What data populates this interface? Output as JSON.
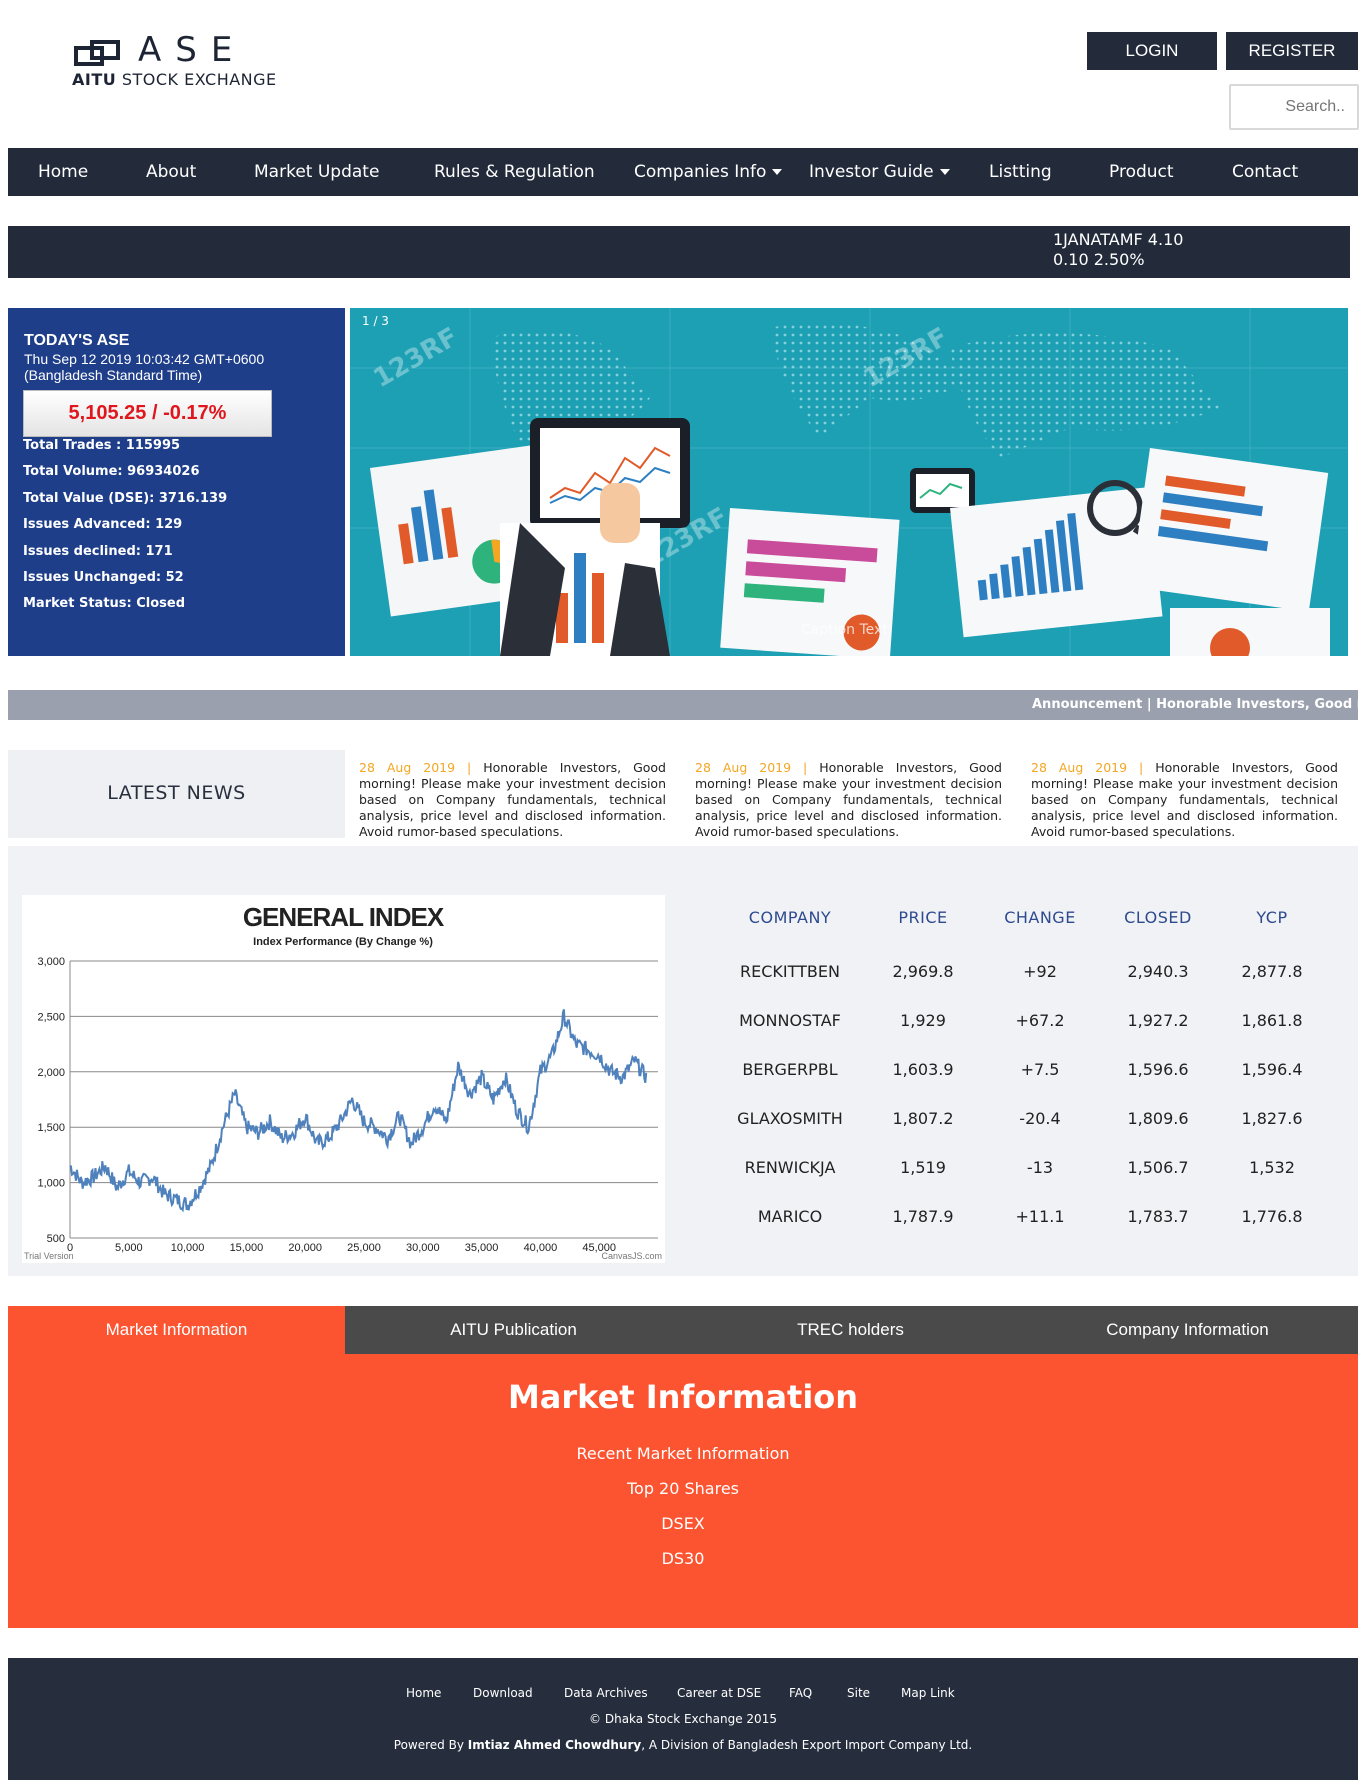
{
  "logo": {
    "brand": "ASE",
    "sub_bold": "AITU",
    "sub_rest": "STOCK EXCHANGE"
  },
  "header": {
    "login_label": "LOGIN",
    "register_label": "REGISTER",
    "search_placeholder": "Search.."
  },
  "nav": {
    "items": [
      "Home",
      "About",
      "Market Update",
      "Rules & Regulation",
      "Companies Info",
      "Investor Guide",
      "Listting",
      "Product",
      "Contact"
    ]
  },
  "ticker": {
    "line1": "1JANATAMF 4.10",
    "line2": "0.10 2.50%"
  },
  "today": {
    "title": "TODAY'S ASE",
    "datetime": "Thu Sep 12 2019 10:03:42 GMT+0600",
    "timezone": "(Bangladesh Standard Time)",
    "index_value": "5,105.25 / -0.17%",
    "stats": [
      "Total Trades : 115995",
      "Total Volume: 96934026",
      "Total Value (DSE): 3716.139",
      "Issues Advanced: 129",
      "Issues declined: 171",
      "Issues Unchanged: 52",
      "Market Status: Closed"
    ]
  },
  "slider": {
    "counter": "1 / 3",
    "caption": "Caption Text",
    "watermark": "123RF"
  },
  "announcement": {
    "text": "Announcement | Honorable Investors, Good mor"
  },
  "news": {
    "label": "LATEST NEWS",
    "items": [
      {
        "date": "28 Aug 2019 |",
        "text": "Honorable Investors, Good morning! Please make your investment decision based on Company fundamentals, technical analysis, price level and disclosed information. Avoid rumor-based speculations."
      },
      {
        "date": "28 Aug 2019 |",
        "text": "Honorable Investors, Good morning! Please make your investment decision based on Company fundamentals, technical analysis, price level and disclosed information. Avoid rumor-based speculations."
      },
      {
        "date": "28 Aug 2019 |",
        "text": "Honorable Investors, Good morning! Please make your investment decision based on Company fundamentals, technical analysis, price level and disclosed information. Avoid rumor-based speculations."
      }
    ]
  },
  "chart_data": {
    "type": "line",
    "title": "GENERAL INDEX",
    "subtitle": "Index Performance (By Change %)",
    "xlabel": "",
    "ylabel": "",
    "xlim": [
      0,
      50000
    ],
    "ylim": [
      500,
      3000
    ],
    "x_ticks": [
      0,
      5000,
      10000,
      15000,
      20000,
      25000,
      30000,
      35000,
      40000,
      45000
    ],
    "y_ticks": [
      500,
      1000,
      1500,
      2000,
      2500,
      3000
    ],
    "x_tick_labels": [
      "0",
      "5,000",
      "10,000",
      "15,000",
      "20,000",
      "25,000",
      "30,000",
      "35,000",
      "40,000",
      "45,000"
    ],
    "y_tick_labels": [
      "500",
      "1,000",
      "1,500",
      "2,000",
      "2,500",
      "3,000"
    ],
    "grid": true,
    "series_color": "#4f81bc",
    "x": [
      0,
      1000,
      2000,
      3000,
      4000,
      5000,
      6000,
      7000,
      8000,
      9000,
      10000,
      11000,
      12000,
      13000,
      14000,
      15000,
      16000,
      17000,
      18000,
      19000,
      20000,
      21000,
      22000,
      23000,
      24000,
      25000,
      26000,
      27000,
      28000,
      29000,
      30000,
      31000,
      32000,
      33000,
      34000,
      35000,
      36000,
      37000,
      38000,
      39000,
      40000,
      41000,
      42000,
      43000,
      44000,
      45000,
      46000,
      47000,
      48000,
      49000,
      50000
    ],
    "values": [
      1150,
      1000,
      1050,
      1150,
      950,
      1100,
      1000,
      1050,
      900,
      850,
      800,
      950,
      1150,
      1500,
      1800,
      1500,
      1450,
      1550,
      1400,
      1450,
      1600,
      1350,
      1400,
      1550,
      1750,
      1550,
      1500,
      1400,
      1600,
      1350,
      1500,
      1700,
      1550,
      2050,
      1800,
      1950,
      1750,
      1950,
      1650,
      1500,
      2000,
      2150,
      2500,
      2250,
      2200,
      2150,
      2000,
      1950,
      2100,
      1950,
      1750
    ]
  },
  "table": {
    "headers": [
      "COMPANY",
      "PRICE",
      "CHANGE",
      "CLOSED",
      "YCP"
    ],
    "rows": [
      [
        "RECKITTBEN",
        "2,969.8",
        "+92",
        "2,940.3",
        "2,877.8"
      ],
      [
        "MONNOSTAF",
        "1,929",
        "+67.2",
        "1,927.2",
        "1,861.8"
      ],
      [
        "BERGERPBL",
        "1,603.9",
        "+7.5",
        "1,596.6",
        "1,596.4"
      ],
      [
        "GLAXOSMITH",
        "1,807.2",
        "-20.4",
        "1,809.6",
        "1,827.6"
      ],
      [
        "RENWICKJA",
        "1,519",
        "-13",
        "1,506.7",
        "1,532"
      ],
      [
        "MARICO",
        "1,787.9",
        "+11.1",
        "1,783.7",
        "1,776.8"
      ]
    ]
  },
  "tabs": {
    "items": [
      "Market Information",
      "AITU Publication",
      "TREC holders",
      "Company Information"
    ]
  },
  "market": {
    "heading": "Market Information",
    "links": [
      "Recent Market Information",
      "Top 20 Shares",
      "DSEX",
      "DS30"
    ]
  },
  "footer": {
    "links": [
      "Home",
      "Download",
      "Data Archives",
      "Career at DSE",
      "FAQ",
      "Site",
      "Map Link"
    ],
    "copyright": "© Dhaka Stock Exchange 2015",
    "powered_prefix": "Powered By",
    "powered_name": "Imtiaz Ahmed Chowdhury",
    "powered_suffix": ", A Division of Bangladesh Export Import Company Ltd."
  },
  "colors": {
    "navy": "#232b3b",
    "blue_panel": "#1e3e8a",
    "orange": "#fc5430",
    "news_date": "#f5a623",
    "header_blue": "#2e4a8e"
  }
}
